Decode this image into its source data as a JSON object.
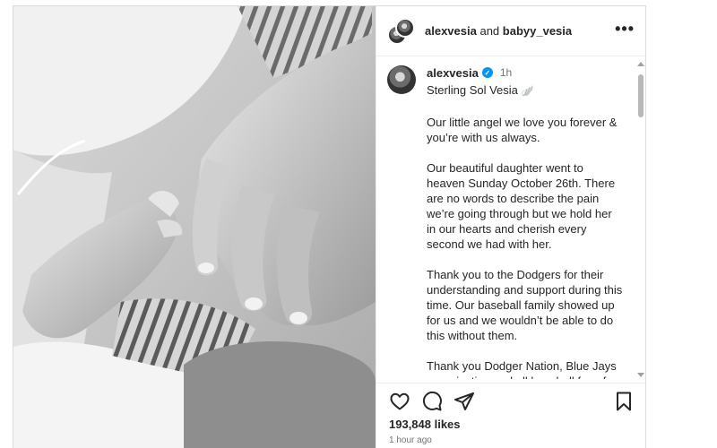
{
  "header": {
    "user1": "alexvesia",
    "conjunction": "and",
    "user2": "babyy_vesia",
    "more_label": "•••"
  },
  "caption": {
    "username": "alexvesia",
    "verified_mark": "✓",
    "time": "1h",
    "title": "Sterling Sol Vesia",
    "title_emoji": "🪽",
    "paragraphs": [
      "Our little angel we love you forever & you’re with us always.",
      "Our beautiful daughter went to heaven Sunday October 26th. There are no words to describe the pain we’re going through but we hold her in our hearts and cherish every second we had with her.",
      "Thank you to the Dodgers for their understanding and support during this time. Our baseball family showed up for us and we wouldn’t be able to do this without them.",
      "Thank you Dodger Nation, Blue Jays organization and all baseball fans for your love and support. We have seen"
    ]
  },
  "actions": {
    "like_icon": "heart-icon",
    "comment_icon": "comment-icon",
    "share_icon": "share-icon",
    "save_icon": "bookmark-icon",
    "likes": "193,848 likes",
    "posted": "1 hour ago"
  },
  "colors": {
    "verified": "#0095f6",
    "text": "#262626",
    "muted": "#737373",
    "border": "#dbdbdb"
  }
}
